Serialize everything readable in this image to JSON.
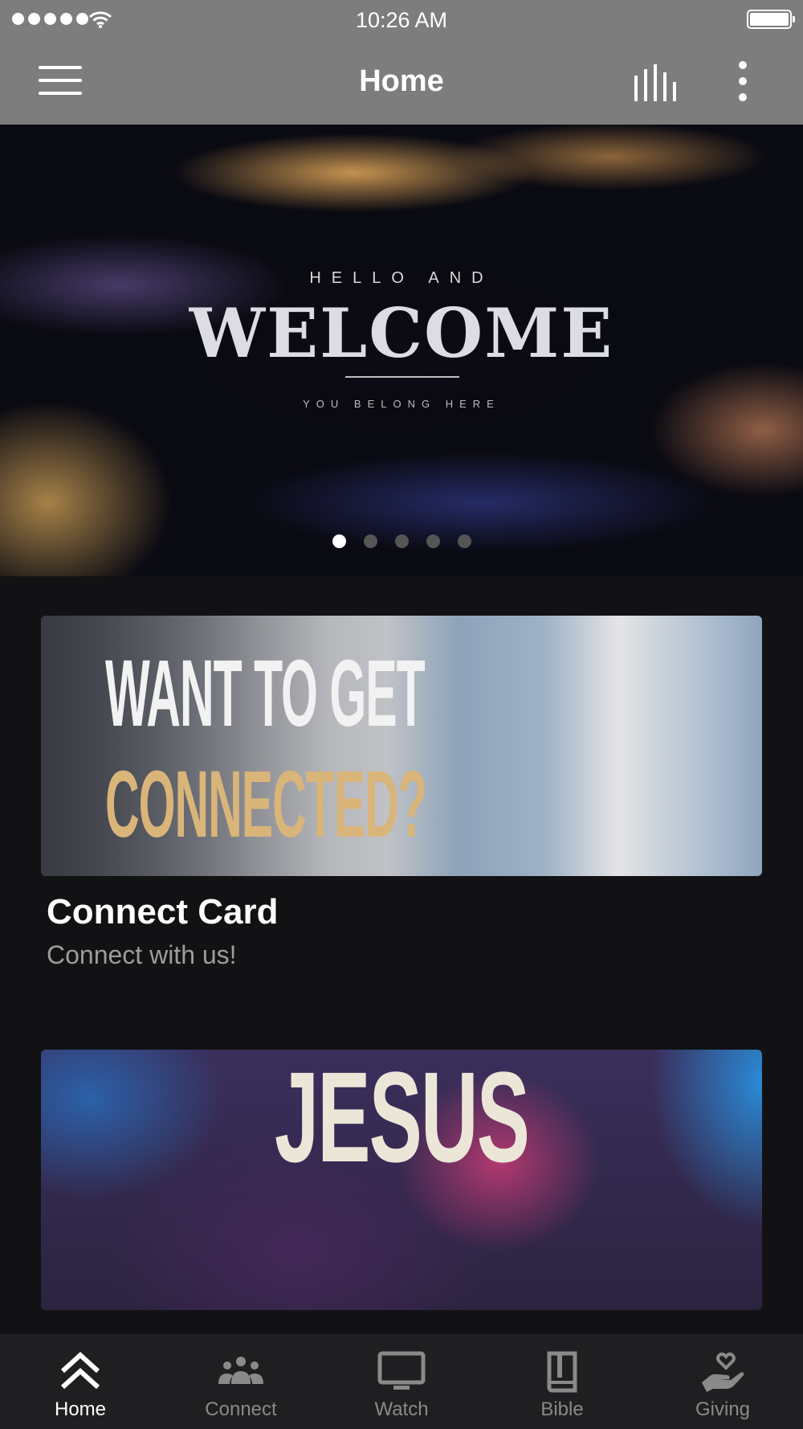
{
  "status_bar": {
    "time": "10:26 AM"
  },
  "app_bar": {
    "title": "Home"
  },
  "hero": {
    "line1": "HELLO AND",
    "line2": "WELCOME",
    "line3": "YOU BELONG HERE",
    "pager": {
      "count": 5,
      "active": 1
    }
  },
  "cards": [
    {
      "image_line1": "WANT TO GET",
      "image_line2": "CONNECTED?",
      "title": "Connect Card",
      "subtitle": "Connect with us!"
    },
    {
      "image_word": "JESUS"
    }
  ],
  "tab_bar": {
    "items": [
      {
        "label": "Home",
        "icon": "double-chevron-up-icon",
        "active": true
      },
      {
        "label": "Connect",
        "icon": "people-icon",
        "active": false
      },
      {
        "label": "Watch",
        "icon": "monitor-icon",
        "active": false
      },
      {
        "label": "Bible",
        "icon": "book-icon",
        "active": false
      },
      {
        "label": "Giving",
        "icon": "hand-heart-icon",
        "active": false
      }
    ]
  },
  "colors": {
    "app_bar": "#7d7d7d",
    "background": "#121214",
    "tab_bar": "#1f1f21",
    "accent_gold": "#d9b57a"
  }
}
